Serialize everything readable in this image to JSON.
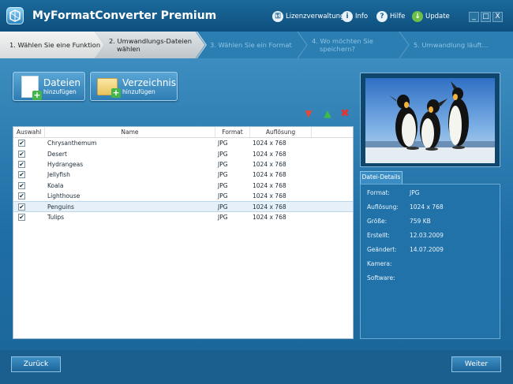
{
  "window": {
    "title": "MyFormatConverter Premium",
    "menu": [
      {
        "label": "Lizenzverwaltung",
        "icon": "key-icon"
      },
      {
        "label": "Info",
        "icon": "info-icon"
      },
      {
        "label": "Hilfe",
        "icon": "help-icon"
      },
      {
        "label": "Update",
        "icon": "update-icon"
      }
    ],
    "controls": {
      "minimize": "_",
      "maximize": "□",
      "close": "X"
    }
  },
  "steps": [
    {
      "line1": "1. Wählen Sie eine Funktion",
      "line2": "",
      "state": "done"
    },
    {
      "line1": "2. Umwandlungs-Dateien",
      "line2": "wählen",
      "state": "active"
    },
    {
      "line1": "3. Wählen Sie ein Format",
      "line2": "",
      "state": "pending"
    },
    {
      "line1": "4. Wo möchten Sie",
      "line2": "speichern?",
      "state": "pending"
    },
    {
      "line1": "5. Umwandlung läuft...",
      "line2": "",
      "state": "pending"
    }
  ],
  "add_buttons": {
    "files": {
      "title": "Dateien",
      "subtitle": "hinzufügen"
    },
    "folder": {
      "title": "Verzeichnis",
      "subtitle": "hinzufügen"
    }
  },
  "table": {
    "headers": [
      "Auswahl",
      "Name",
      "Format",
      "Auflösung"
    ],
    "rows": [
      {
        "checked": "✔",
        "name": "Chrysanthemum",
        "format": "JPG",
        "resolution": "1024 x 768"
      },
      {
        "checked": "✔",
        "name": "Desert",
        "format": "JPG",
        "resolution": "1024 x 768"
      },
      {
        "checked": "✔",
        "name": "Hydrangeas",
        "format": "JPG",
        "resolution": "1024 x 768"
      },
      {
        "checked": "✔",
        "name": "Jellyfish",
        "format": "JPG",
        "resolution": "1024 x 768"
      },
      {
        "checked": "✔",
        "name": "Koala",
        "format": "JPG",
        "resolution": "1024 x 768"
      },
      {
        "checked": "✔",
        "name": "Lighthouse",
        "format": "JPG",
        "resolution": "1024 x 768"
      },
      {
        "checked": "✔",
        "name": "Penguins",
        "format": "JPG",
        "resolution": "1024 x 768"
      },
      {
        "checked": "✔",
        "name": "Tulips",
        "format": "JPG",
        "resolution": "1024 x 768"
      }
    ],
    "selected_row": "Penguins"
  },
  "details": {
    "tab_label": "Datei-Details",
    "fields": [
      {
        "key": "Format:",
        "value": "JPG"
      },
      {
        "key": "Auflösung:",
        "value": "1024 x 768"
      },
      {
        "key": "Größe:",
        "value": "759 KB"
      },
      {
        "key": "Erstellt:",
        "value": "12.03.2009"
      },
      {
        "key": "Geändert:",
        "value": "14.07.2009"
      },
      {
        "key": "Kamera:",
        "value": ""
      },
      {
        "key": "Software:",
        "value": ""
      }
    ]
  },
  "footer": {
    "back": "Zurück",
    "next": "Weiter"
  }
}
